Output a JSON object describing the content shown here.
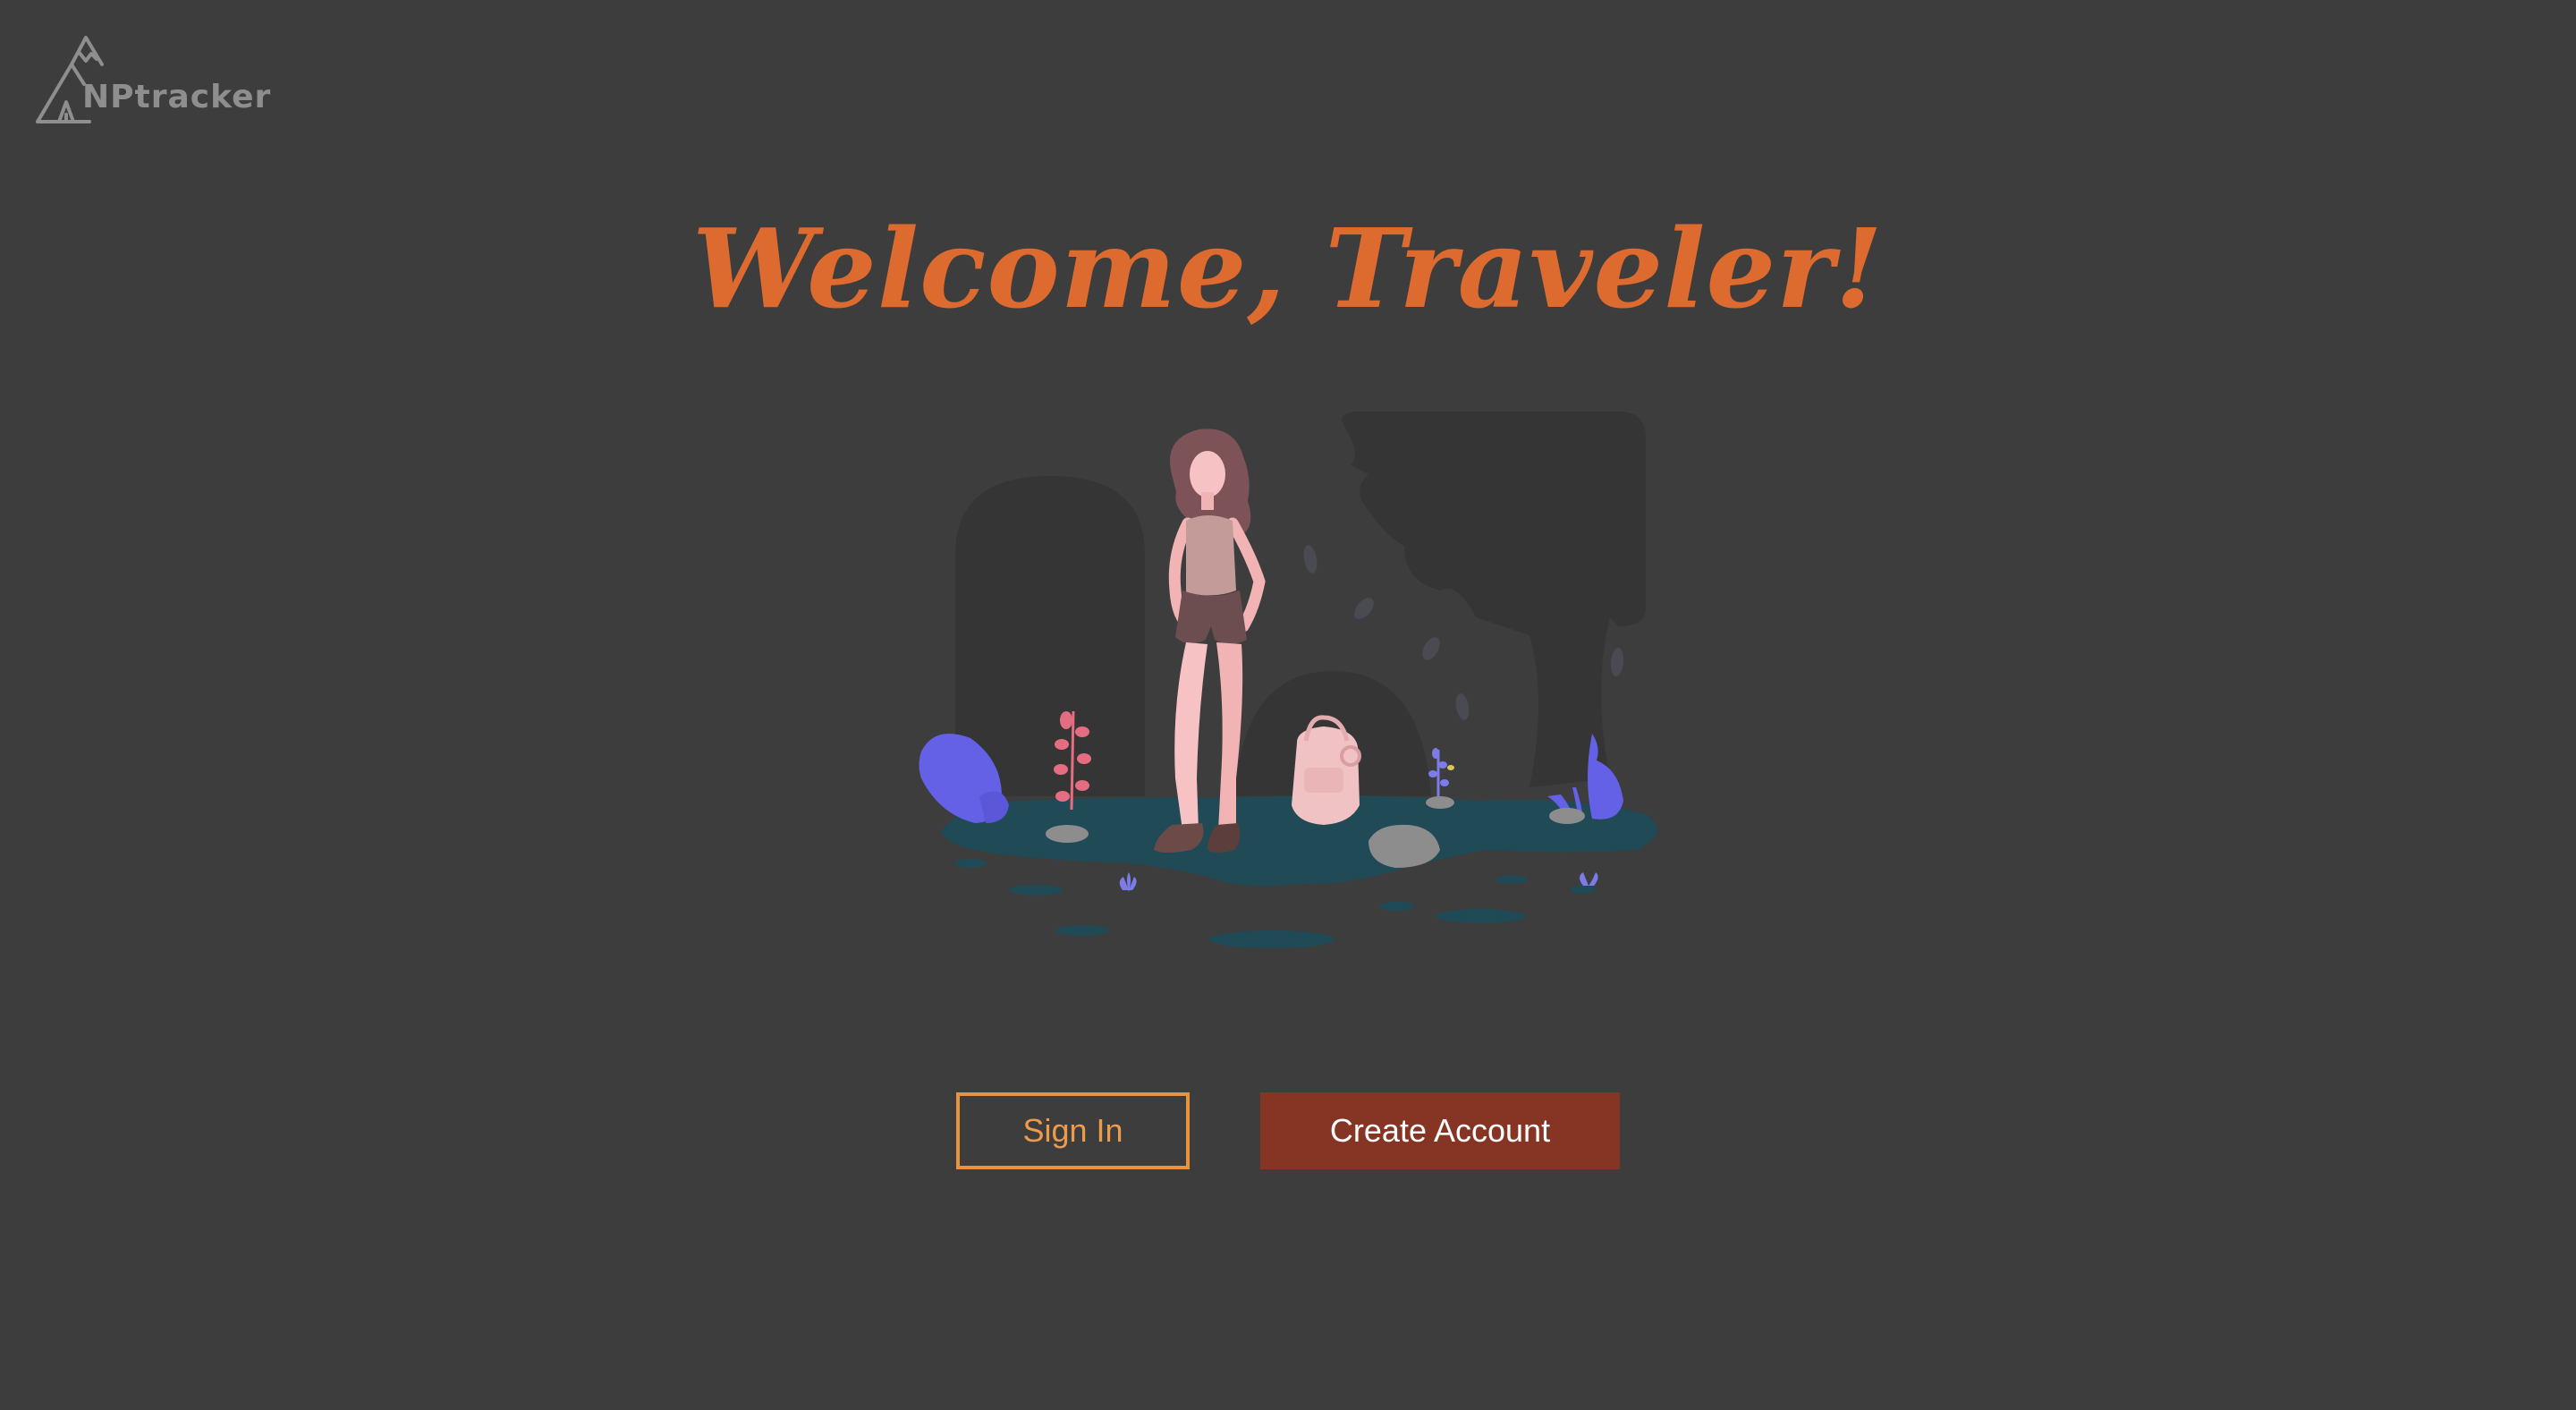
{
  "app": {
    "brand_name": "NPtracker"
  },
  "hero": {
    "headline": "Welcome, Traveler!"
  },
  "actions": {
    "sign_in_label": "Sign In",
    "create_account_label": "Create Account"
  },
  "colors": {
    "background": "#3d3d3d",
    "headline": "#dd6a2f",
    "sign_in_border": "#e8933f",
    "create_account_bg": "#863525",
    "logo": "#8e8e8e"
  }
}
